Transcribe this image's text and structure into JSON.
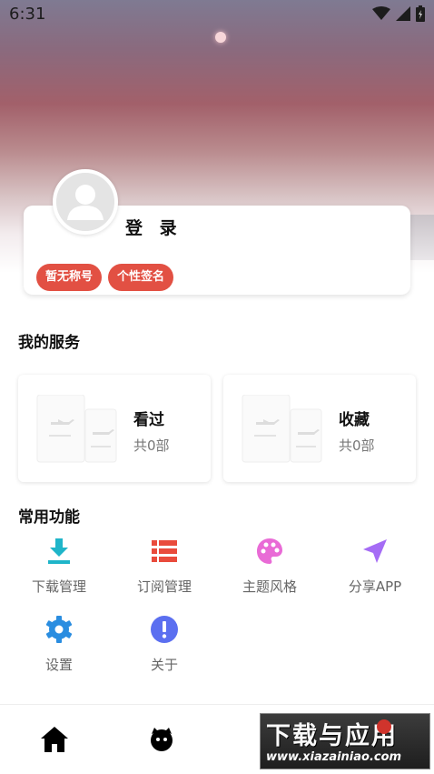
{
  "status_bar": {
    "time": "6:31"
  },
  "profile": {
    "login_label": "登 录",
    "tags": [
      "暂无称号",
      "个性签名"
    ]
  },
  "services": {
    "title": "我的服务",
    "cards": [
      {
        "title": "看过",
        "count": "共0部"
      },
      {
        "title": "收藏",
        "count": "共0部"
      }
    ]
  },
  "functions": {
    "title": "常用功能",
    "items": [
      {
        "label": "下载管理",
        "icon": "download-icon",
        "color": "#1fb5c9"
      },
      {
        "label": "订阅管理",
        "icon": "list-icon",
        "color": "#e94b3c"
      },
      {
        "label": "主题风格",
        "icon": "palette-icon",
        "color": "#e96bd6"
      },
      {
        "label": "分享APP",
        "icon": "send-icon",
        "color": "#a56cf5"
      },
      {
        "label": "设置",
        "icon": "gear-icon",
        "color": "#2a8de0"
      },
      {
        "label": "关于",
        "icon": "info-icon",
        "color": "#5b6ff0"
      }
    ]
  },
  "bottom_nav": {
    "items": [
      {
        "icon": "home-icon"
      },
      {
        "icon": "face-icon"
      }
    ]
  },
  "watermark": {
    "main": "下载与应用",
    "url": "www.xiazainiao.com"
  }
}
